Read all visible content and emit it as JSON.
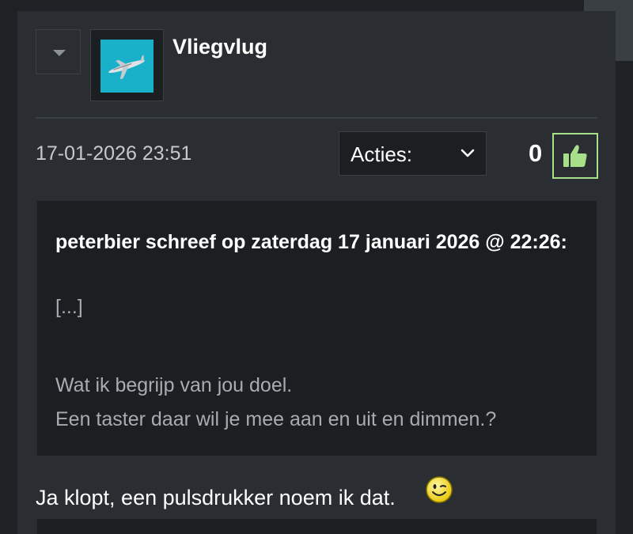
{
  "post": {
    "username": "Vliegvlug",
    "date": "17-01-2026 23:51",
    "actions_label": "Acties:",
    "like_count": "0"
  },
  "quote": {
    "author_line": "peterbier schreef op zaterdag 17 januari 2026 @ 22:26:",
    "ellipsis": "[...]",
    "line1": "Wat ik begrijp van jou doel.",
    "line2": "Een taster daar wil je mee aan en uit en dimmen.?"
  },
  "reply": {
    "text": "Ja klopt, een pulsdrukker noem ik dat."
  },
  "icons": {
    "collapse": "triangle-down-icon",
    "sidebar": "chevron-left-icon",
    "select": "chevron-down-icon",
    "like": "thumbs-up-icon",
    "smiley": "wink-smiley-icon",
    "avatar": "airplane-icon"
  },
  "colors": {
    "avatar_bg": "#19b0c9",
    "like_accent": "#a8e08a",
    "card_bg": "#2a2e32",
    "quote_bg": "#1c1f22"
  }
}
